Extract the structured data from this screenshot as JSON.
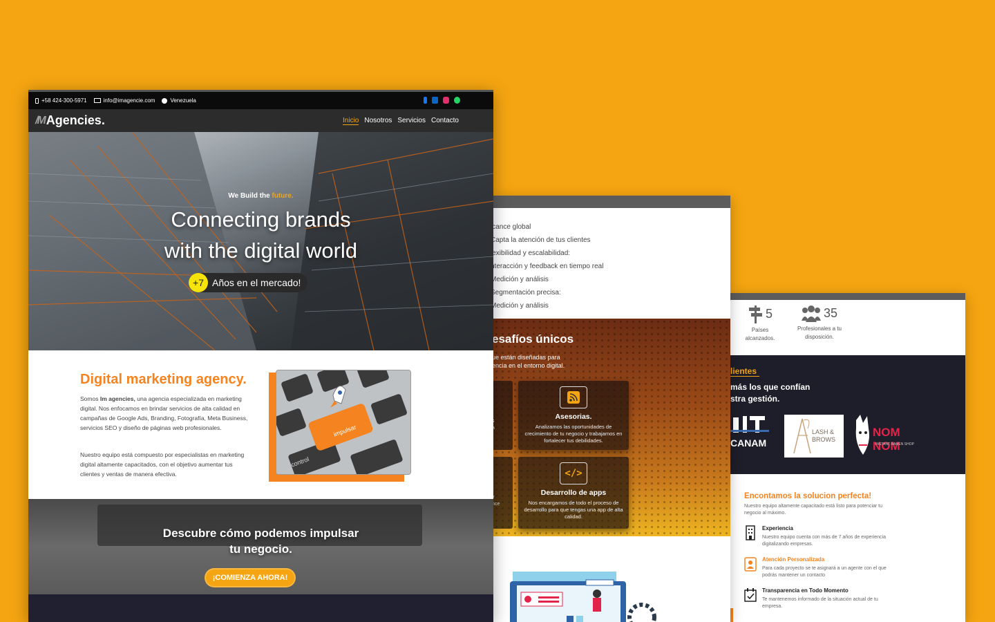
{
  "colors": {
    "background": "#F5A511",
    "accent": "#F5A511",
    "orange": "#F5831F",
    "dark": "#1E1E2A"
  },
  "panel1": {
    "topbar": {
      "phone": "+58 424-300-5971",
      "email": "info@imagencie.com",
      "location": "Venezuela"
    },
    "brand": "Agencies.",
    "nav": [
      "Inicio",
      "Nosotros",
      "Servicios",
      "Contacto"
    ],
    "hero": {
      "tagline_pre": "We Build the ",
      "tagline_accent": "future.",
      "title_line1": "Connecting brands",
      "title_line2": "with the digital world",
      "years_num": "+7",
      "years_text": "Años en el mercado!"
    },
    "about": {
      "title": "Digital marketing agency.",
      "p1_pre": "Somos ",
      "p1_bold": "Im agencies,",
      "p1_post": " una agencia especializada en marketing digital.  Nos enfocamos en brindar servicios de alta calidad en campañas de Google Ads,  Branding,  Fotografía,  Meta Business, servicios SEO y diseño de páginas web profesionales.",
      "p2": "Nuestro equipo está compuesto por especialistas en marketing digital altamente capacitados, con el objetivo aumentar tus clientes y ventas de manera efectiva.",
      "key_label": "impulsar",
      "key2_label": "control"
    },
    "cta": {
      "line1": "Descubre cómo podemos impulsar",
      "line2": "tu negocio.",
      "button": "¡COMIENZA AHORA!"
    }
  },
  "panel2": {
    "benefits": [
      "lcance global",
      "Capta la atención de tus clientes",
      "lexibilidad y escalabilidad:",
      "nteracción y feedback en tiempo real",
      "Medición y análisis",
      "Segmentación precisa:",
      "Medición y análisis"
    ],
    "section_title": "esafíos únicos",
    "section_sub_line1": "ue están diseñadas para",
    "section_sub_line2": "encia en el entorno digital.",
    "cards": [
      {
        "title": "Asesorias.",
        "text": "Analizamos las oportunidades de crecimiento de tu negocio y trabajamos en fortalecer tus debilidades."
      },
      {
        "title": "Desarrollo de apps",
        "text": "Nos encargamos de todo el proceso de desarrollo para que tengas una app de alta calidad."
      }
    ],
    "left_card_frag": [
      "s",
      "a"
    ],
    "left_card_frag2": [
      "y",
      "nce"
    ]
  },
  "panel3": {
    "stats": [
      {
        "number": "5",
        "label_line1": "Países",
        "label_line2": "alcanzados.",
        "icon": "signpost-icon"
      },
      {
        "number": "35",
        "label_line1": "Profesionales a tu",
        "label_line2": "disposición.",
        "icon": "users-icon"
      }
    ],
    "clients_title": "lientes",
    "clients_sub_line1": "más los que confían",
    "clients_sub_line2": "stra gestión.",
    "logos": {
      "canam": "CANAM",
      "lash_line1": "LASH &",
      "lash_line2": "BROWS",
      "nom": "NOM NOM",
      "nom_sub": "INSTANT RAMEN SHOP"
    },
    "solution_title": "Encontamos la solucion perfecta!",
    "solution_text": "Nuestro equipo altamente capacitado está listo para potenciar tu negocio al máximo.",
    "features": [
      {
        "title": "Experiencia",
        "text": "Nuestro equipo cuenta con más de 7 años de experiencia digitalizando empresas.",
        "icon": "building-icon"
      },
      {
        "title": "Atención  Personalizada",
        "text": "Para cada proyecto se te asignará a un agente con el que podrás mantener un contacto",
        "icon": "user-badge-icon"
      },
      {
        "title": "Transparencia en Todo  Momento",
        "text": "Te mantenemos informado de la situación actual de tu empresa.",
        "icon": "calendar-check-icon"
      }
    ]
  }
}
